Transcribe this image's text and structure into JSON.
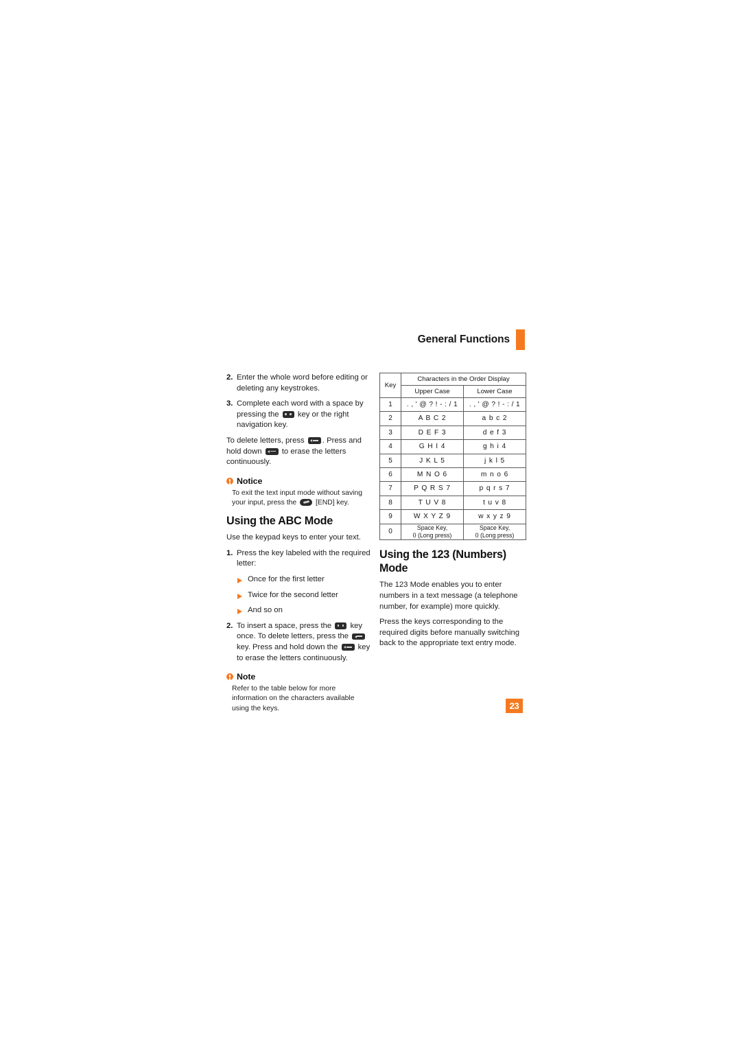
{
  "header": {
    "title": "General Functions",
    "accent_color": "#F57A1F"
  },
  "left_column": {
    "steps_continued": [
      {
        "num": "2.",
        "text": "Enter the whole word before editing or deleting any keystrokes."
      }
    ],
    "step3": {
      "num": "3.",
      "part1": "Complete each word with a space by pressing the",
      "part2": "key or the right navigation key."
    },
    "delete_para": {
      "part1": "To delete letters, press",
      "part2": ". Press and hold down",
      "part3": "to erase the letters continuously."
    },
    "notice": {
      "title": "Notice",
      "part1": "To exit the text input mode without saving your input, press the",
      "part2": "[END] key."
    },
    "abc_heading": "Using the ABC Mode",
    "abc_intro": "Use the keypad keys to enter your text.",
    "abc_step1": {
      "num": "1.",
      "text": "Press the key labeled with the required letter:"
    },
    "abc_bullets": [
      "Once for the first letter",
      "Twice for the second letter",
      "And so on"
    ],
    "abc_step2": {
      "num": "2.",
      "part1": "To insert a space, press the",
      "part2": "key once. To delete letters, press the",
      "part3": "key. Press and hold down the",
      "part4": "key to erase the letters continuously."
    },
    "note": {
      "title": "Note",
      "body": "Refer to the table below for more information on the characters available using the keys."
    }
  },
  "right_column": {
    "table": {
      "key_header": "Key",
      "span_header": "Characters in the Order Display",
      "sub_headers": [
        "Upper Case",
        "Lower Case"
      ],
      "rows": [
        {
          "key": "1",
          "upper": ". , ' @ ? ! - : / 1",
          "lower": ". , ' @ ? ! - : / 1"
        },
        {
          "key": "2",
          "upper": "A B C 2",
          "lower": "a b c 2"
        },
        {
          "key": "3",
          "upper": "D E F 3",
          "lower": "d e f 3"
        },
        {
          "key": "4",
          "upper": "G H I 4",
          "lower": "g h i 4"
        },
        {
          "key": "5",
          "upper": "J K L 5",
          "lower": "j k l 5"
        },
        {
          "key": "6",
          "upper": "M N O 6",
          "lower": "m n o 6"
        },
        {
          "key": "7",
          "upper": "P Q R S 7",
          "lower": "p q r s 7"
        },
        {
          "key": "8",
          "upper": "T U V 8",
          "lower": "t u v 8"
        },
        {
          "key": "9",
          "upper": "W X Y Z 9",
          "lower": "w x y z 9"
        }
      ],
      "zero_row": {
        "key": "0",
        "upper_line1": "Space Key,",
        "upper_line2": "0 (Long press)",
        "lower_line1": "Space Key,",
        "lower_line2": "0 (Long press)"
      }
    },
    "numbers_heading": "Using the 123 (Numbers) Mode",
    "numbers_para1": "The 123 Mode enables you to enter numbers in a text message (a telephone number, for example) more quickly.",
    "numbers_para2": "Press the keys corresponding to the required digits before manually switching back to the appropriate text entry mode."
  },
  "footer": {
    "page_number": "23"
  }
}
